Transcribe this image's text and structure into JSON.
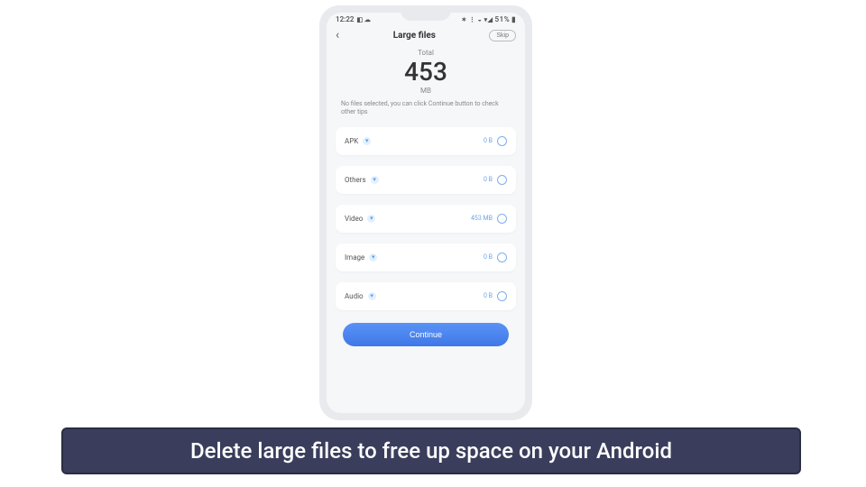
{
  "status_bar": {
    "time": "12:22",
    "left_icons": "◧ ☁",
    "right_icons": "✶ ⋮ ◒ ▾◢",
    "battery_text": "51%",
    "battery_icon": "▮"
  },
  "header": {
    "title": "Large files",
    "skip_label": "Skip"
  },
  "total": {
    "label": "Total",
    "value": "453",
    "unit": "MB",
    "hint": "No files selected, you can click Continue button to check other tips"
  },
  "categories": [
    {
      "label": "APK",
      "size": "0 B"
    },
    {
      "label": "Others",
      "size": "0 B"
    },
    {
      "label": "Video",
      "size": "453 MB"
    },
    {
      "label": "Image",
      "size": "0 B"
    },
    {
      "label": "Audio",
      "size": "0 B"
    }
  ],
  "continue_label": "Continue",
  "caption": "Delete large files to free up space on your Android"
}
